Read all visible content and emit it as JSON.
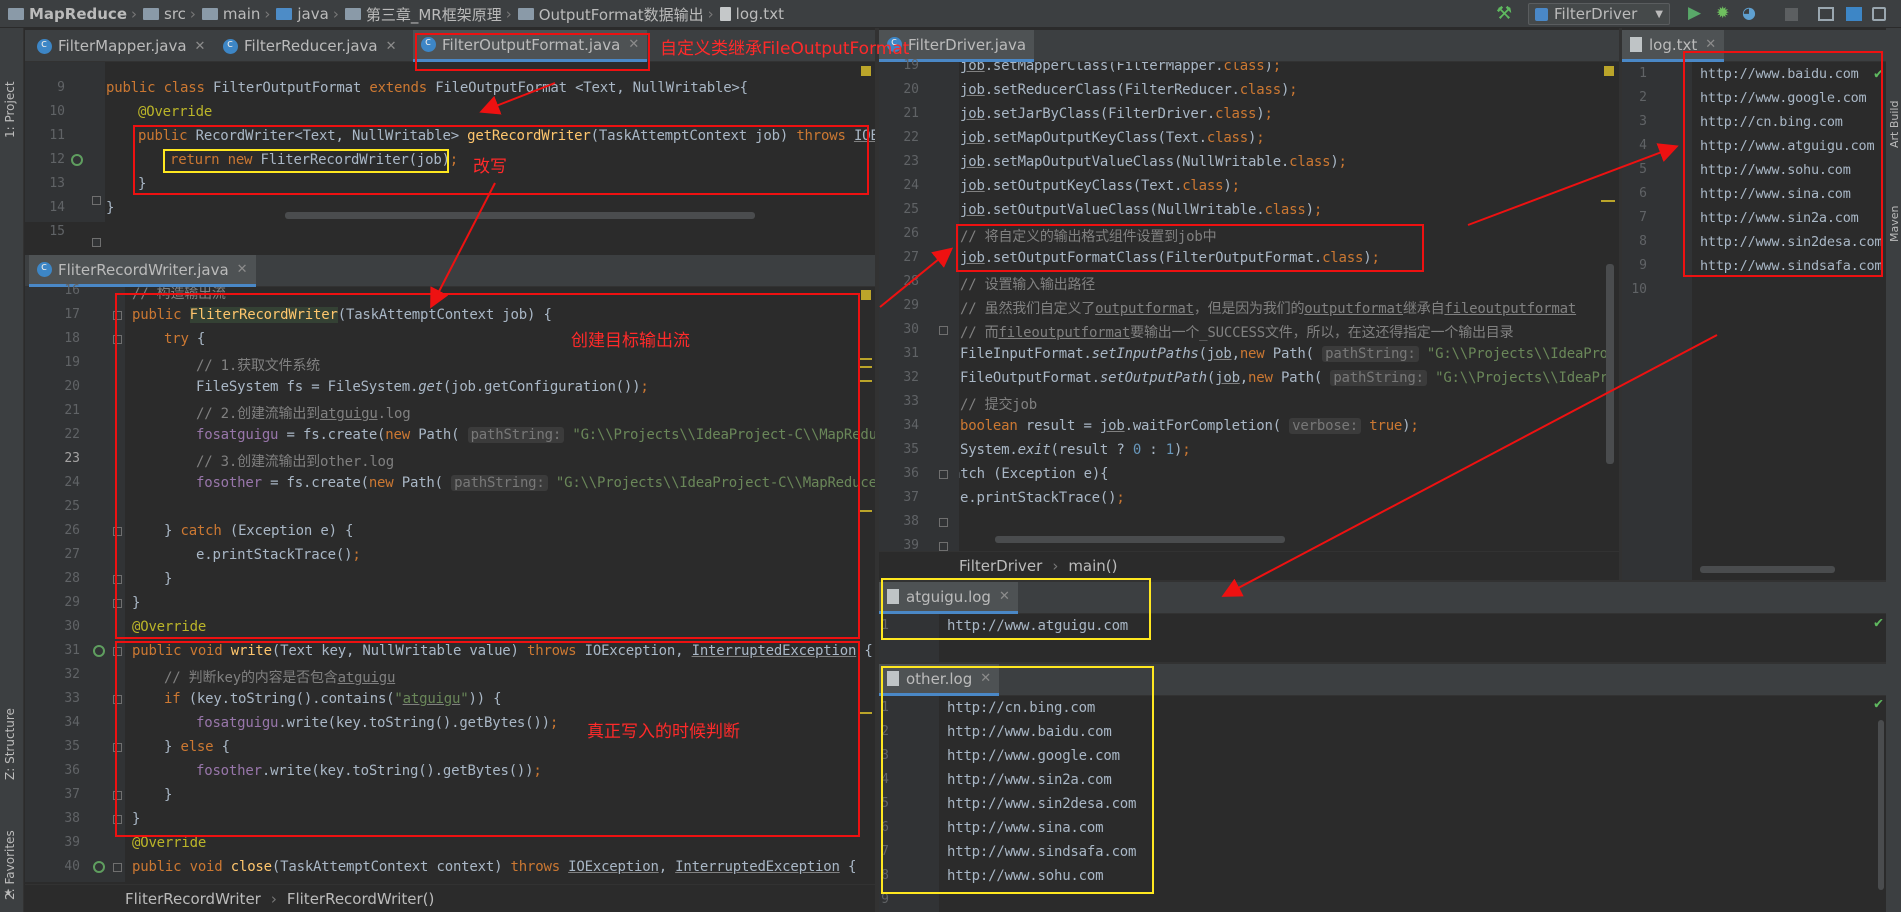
{
  "breadcrumbs": [
    "MapReduce",
    "src",
    "main",
    "java",
    "第三章_MR框架原理",
    "OutputFormat数据输出",
    "log.txt"
  ],
  "run_config": "FilterDriver",
  "left_tool_tabs": [
    "1: Project",
    "Z: Structure",
    "2: Favorites"
  ],
  "right_tool_tabs": [
    "Art Build",
    "Maven"
  ],
  "left_top_tabs": [
    "FilterMapper.java",
    "FilterReducer.java",
    "FilterOutputFormat.java"
  ],
  "left_top_code": {
    "lines": [
      "9",
      "10",
      "11",
      "12",
      "13",
      "14",
      "15"
    ]
  },
  "left_bottom_tab": "FliterRecordWriter.java",
  "left_bottom_lines": [
    "16",
    "17",
    "18",
    "19",
    "20",
    "21",
    "22",
    "23",
    "24",
    "25",
    "26",
    "27",
    "28",
    "29",
    "30",
    "31",
    "32",
    "33",
    "34",
    "35",
    "36",
    "37",
    "38",
    "39",
    "40"
  ],
  "left_bottom_crumbs": [
    "FliterRecordWriter",
    "FliterRecordWriter()"
  ],
  "driver_tab": "FilterDriver.java",
  "driver_lines": [
    "19",
    "20",
    "21",
    "22",
    "23",
    "24",
    "25",
    "26",
    "27",
    "28",
    "29",
    "30",
    "31",
    "32",
    "33",
    "34",
    "35",
    "36",
    "37",
    "38",
    "39"
  ],
  "driver_crumbs": [
    "FilterDriver",
    "main()"
  ],
  "log_tab": "log.txt",
  "log_lines": [
    "http://www.baidu.com",
    "http://www.google.com",
    "http://cn.bing.com",
    "http://www.atguigu.com",
    "http://www.sohu.com",
    "http://www.sina.com",
    "http://www.sin2a.com",
    "http://www.sin2desa.com",
    "http://www.sindsafa.com",
    ""
  ],
  "atguigu_tab": "atguigu.log",
  "atguigu_lines": [
    "http://www.atguigu.com"
  ],
  "other_tab": "other.log",
  "other_lines": [
    "http://cn.bing.com",
    "http://www.baidu.com",
    "http://www.google.com",
    "http://www.sin2a.com",
    "http://www.sin2desa.com",
    "http://www.sina.com",
    "http://www.sindsafa.com",
    "http://www.sohu.com"
  ],
  "annotations": {
    "custom_class": "自定义类继承FileOutputFormat",
    "override": "改写",
    "create_stream": "创建目标输出流",
    "judge": "真正写入的时候判断"
  },
  "colors": {
    "annotation_red": "#ff2a2a",
    "highlight_yellow": "#ffe820",
    "accent_blue": "#4a88c7"
  }
}
